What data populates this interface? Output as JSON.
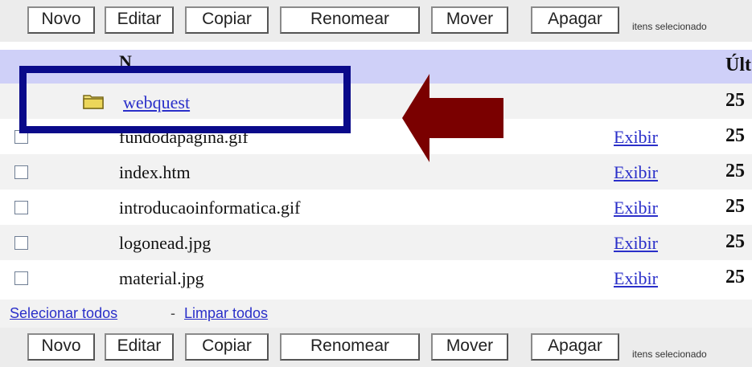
{
  "toolbar_top": {
    "buttons": [
      "Novo",
      "Editar",
      "Copiar",
      "Renomear",
      "Mover",
      "Apagar"
    ],
    "selected_text": "itens selecionado"
  },
  "header": {
    "name": "N",
    "last": "Últ"
  },
  "folder_row": {
    "name": "webquest",
    "date": "25"
  },
  "files": [
    {
      "name": "fundodapagina.gif",
      "action": "Exibir",
      "date": "25"
    },
    {
      "name": "index.htm",
      "action": "Exibir",
      "date": "25"
    },
    {
      "name": "introducaoinformatica.gif",
      "action": "Exibir",
      "date": "25"
    },
    {
      "name": "logonead.jpg",
      "action": "Exibir",
      "date": "25"
    },
    {
      "name": "material.jpg",
      "action": "Exibir",
      "date": "25"
    }
  ],
  "selection": {
    "select_all": "Selecionar todos",
    "separator": "-",
    "clear_all": "Limpar todos"
  },
  "toolbar_bottom": {
    "buttons": [
      "Novo",
      "Editar",
      "Copiar",
      "Renomear",
      "Mover",
      "Apagar"
    ],
    "selected_text": "itens selecionado"
  },
  "colors": {
    "highlight_box": "#0a0a8a",
    "arrow": "#7a0000",
    "link": "#2a2fc9",
    "header_bg": "#cfd0f8"
  }
}
